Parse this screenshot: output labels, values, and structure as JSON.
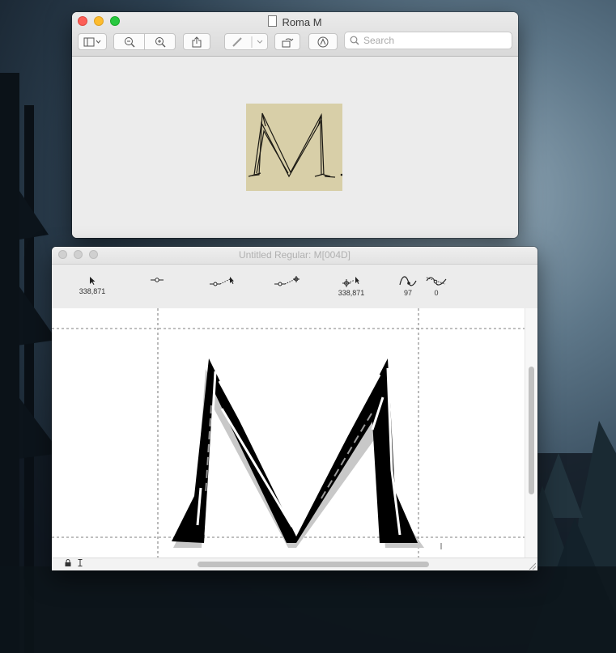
{
  "preview_window": {
    "title": "Roma M",
    "search_placeholder": "Search"
  },
  "editor_window": {
    "title": "Untitled Regular: M[004D]",
    "tools": [
      {
        "name": "pointer",
        "value": "338,871"
      },
      {
        "name": "point",
        "value": ""
      },
      {
        "name": "point-pointer",
        "value": ""
      },
      {
        "name": "point-add",
        "value": ""
      },
      {
        "name": "node-pointer",
        "value": "338,871"
      },
      {
        "name": "curve",
        "value": "97"
      },
      {
        "name": "curve-tangent",
        "value": "0"
      }
    ]
  },
  "colors": {
    "close": "#fc5f57",
    "minimize": "#fdbc2e",
    "maximize": "#28c840",
    "parchment": "#d8cfa8"
  },
  "icons": [
    "sidebar-icon",
    "zoom-out-icon",
    "zoom-in-icon",
    "share-icon",
    "markup-icon",
    "rotate-icon",
    "annotate-icon",
    "search-icon",
    "lock-icon",
    "cursor-icon"
  ]
}
